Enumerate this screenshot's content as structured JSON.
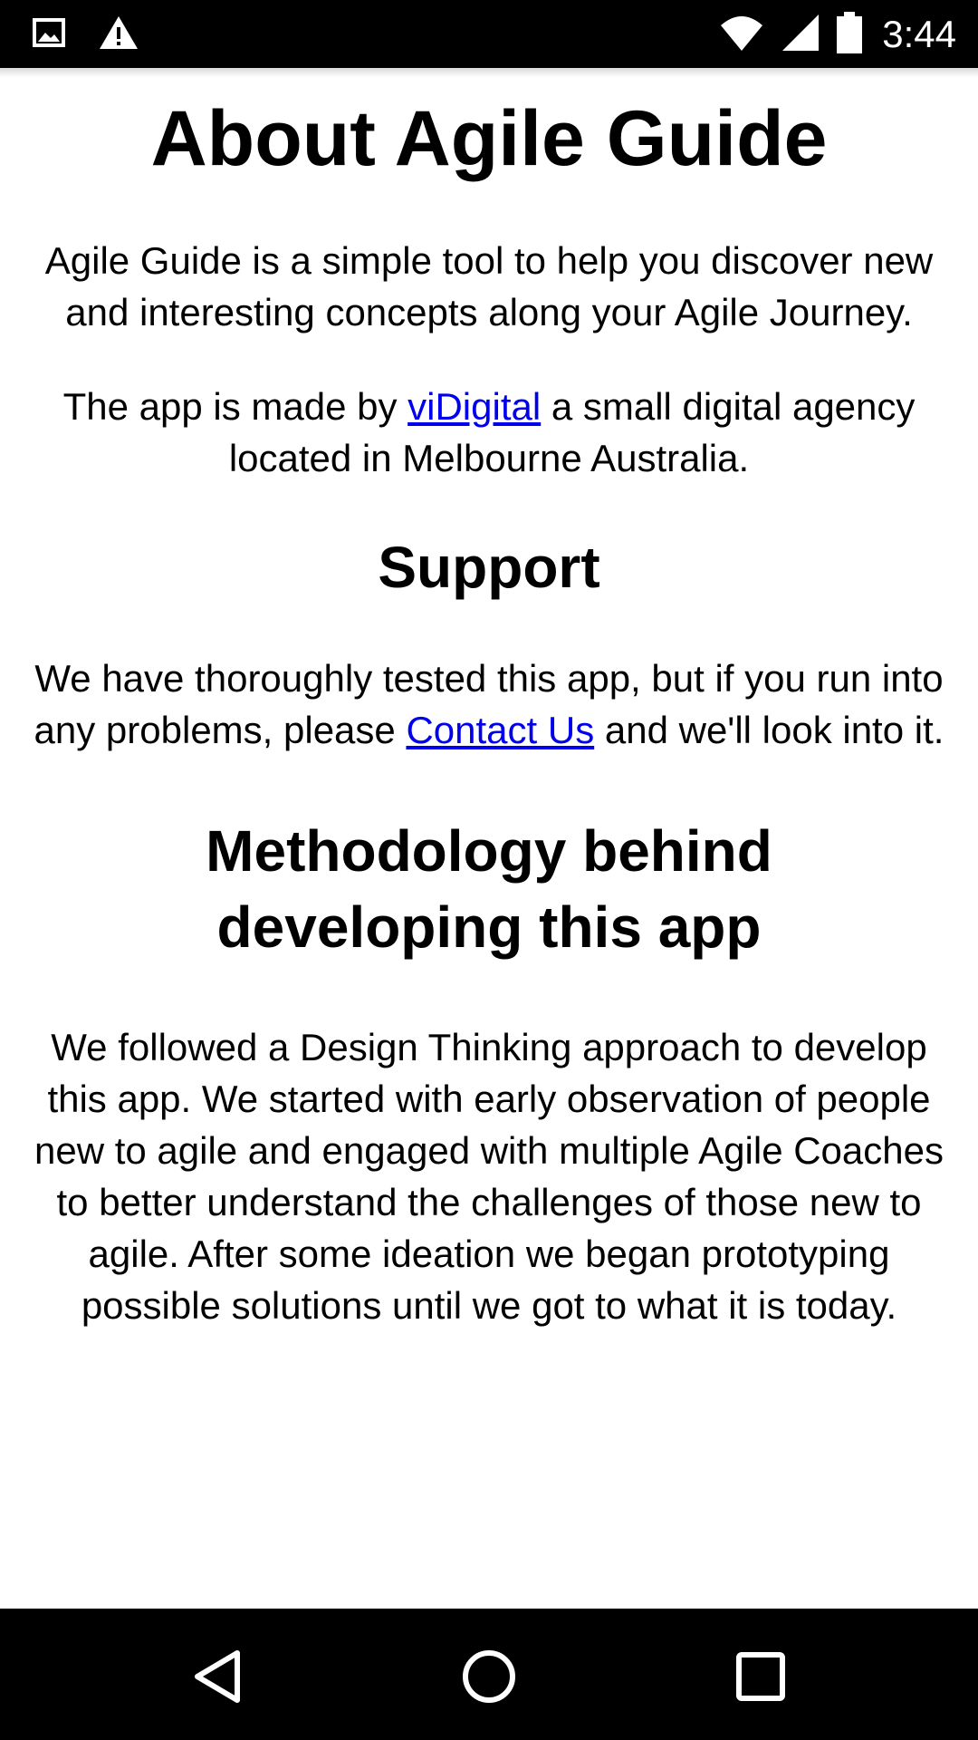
{
  "status_bar": {
    "time": "3:44",
    "icons": [
      "image-icon",
      "warning-icon",
      "wifi-icon",
      "signal-icon",
      "battery-icon"
    ]
  },
  "page": {
    "title": "About Agile Guide",
    "intro": "Agile Guide is a simple tool to help you discover new and interesting concepts along your Agile Journey.",
    "made_by_prefix": "The app is made by ",
    "made_by_link": "viDigital",
    "made_by_suffix": " a small digital agency located in Melbourne Australia.",
    "support_heading": "Support",
    "support_prefix": "We have thoroughly tested this app, but if you run into any problems, please ",
    "support_link": "Contact Us",
    "support_suffix": " and we'll look into it.",
    "method_heading": "Methodology behind developing this app",
    "method_text": "We followed a Design Thinking approach to develop this app. We started with early observation of people new to agile and engaged with multiple Agile Coaches to better understand the challenges of those new to agile. After some ideation we began prototyping possible solutions until we got to what it is today."
  },
  "nav_bar": {
    "buttons": [
      "back-icon",
      "home-icon",
      "recents-icon"
    ]
  },
  "colors": {
    "link": "#0000ee",
    "bars": "#000000"
  }
}
